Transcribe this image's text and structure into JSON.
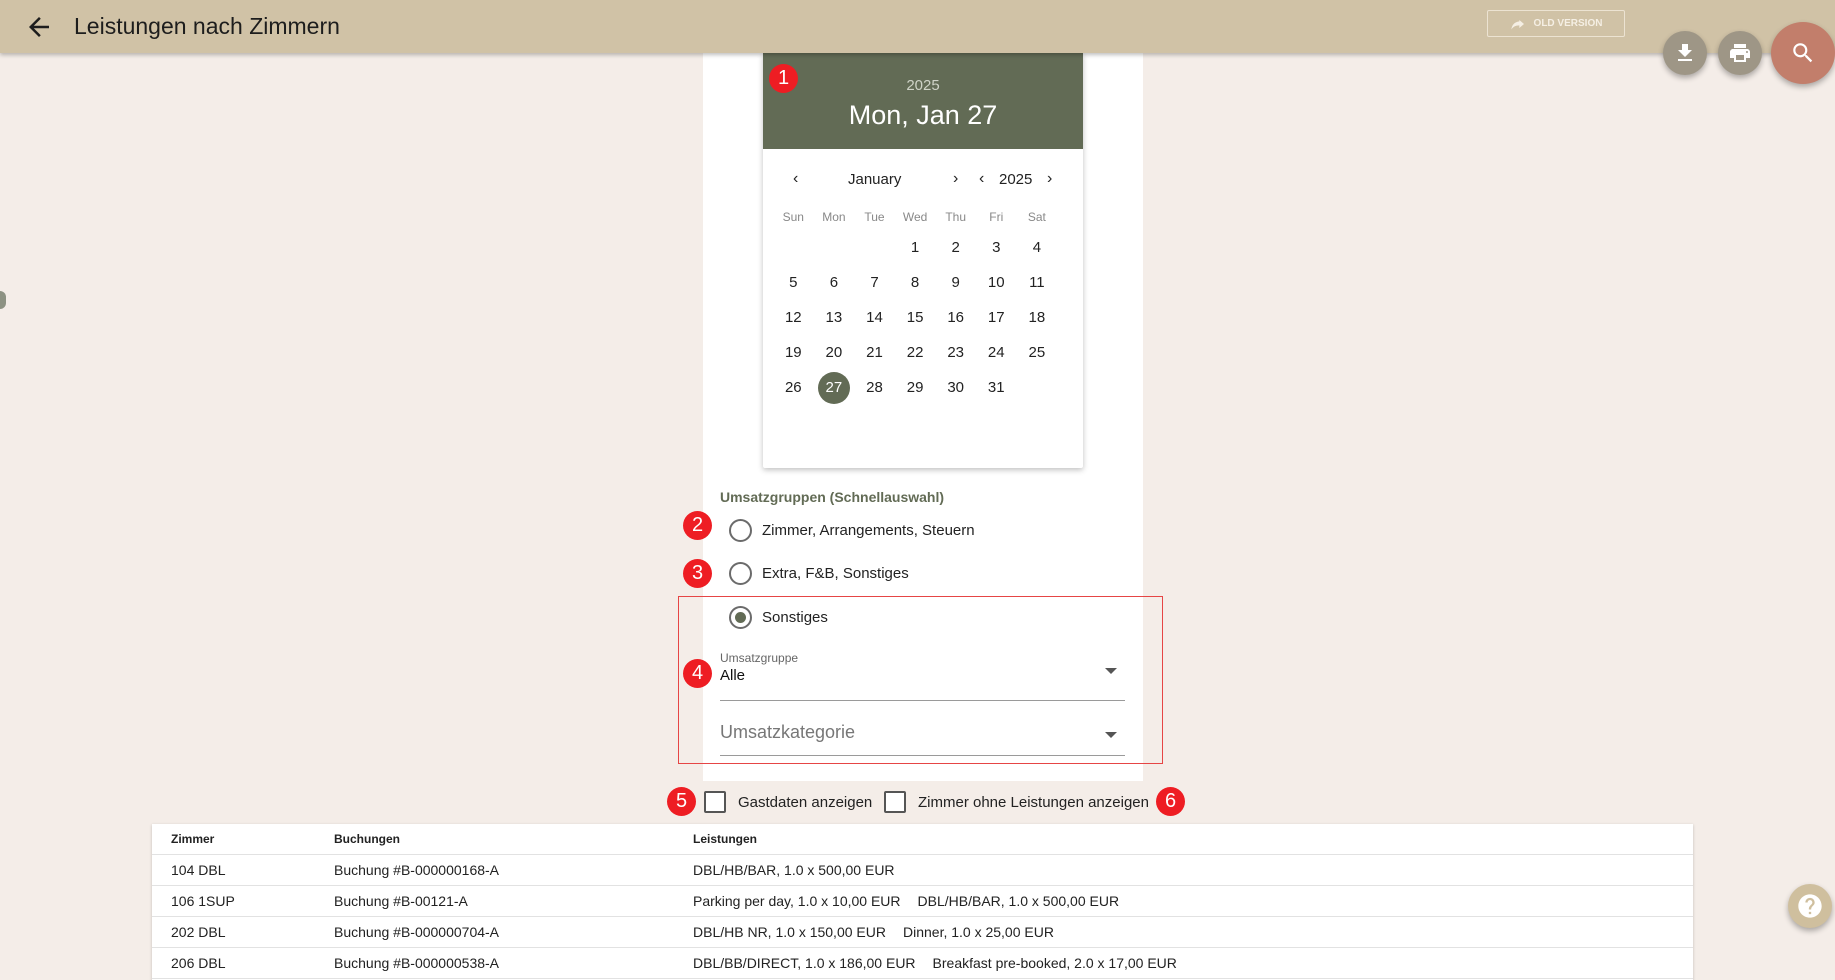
{
  "header": {
    "title": "Leistungen nach Zimmern",
    "old_version_label": "OLD VERSION"
  },
  "datepicker": {
    "header_year": "2025",
    "header_date": "Mon, Jan 27",
    "month": "January",
    "year": "2025",
    "weekdays": [
      "Sun",
      "Mon",
      "Tue",
      "Wed",
      "Thu",
      "Fri",
      "Sat"
    ],
    "weeks": [
      [
        "",
        "",
        "",
        "1",
        "2",
        "3",
        "4"
      ],
      [
        "5",
        "6",
        "7",
        "8",
        "9",
        "10",
        "11"
      ],
      [
        "12",
        "13",
        "14",
        "15",
        "16",
        "17",
        "18"
      ],
      [
        "19",
        "20",
        "21",
        "22",
        "23",
        "24",
        "25"
      ],
      [
        "26",
        "27",
        "28",
        "29",
        "30",
        "31",
        ""
      ]
    ],
    "selected_day": "27"
  },
  "filters": {
    "section_label": "Umsatzgruppen (Schnellauswahl)",
    "radio_options": [
      {
        "label": "Zimmer, Arrangements, Steuern",
        "checked": false
      },
      {
        "label": "Extra, F&B, Sonstiges",
        "checked": false
      },
      {
        "label": "Sonstiges",
        "checked": true
      }
    ],
    "umsatzgruppe_label": "Umsatzgruppe",
    "umsatzgruppe_value": "Alle",
    "umsatzkategorie_placeholder": "Umsatzkategorie",
    "checkbox_gastdaten": "Gastdaten anzeigen",
    "checkbox_zimmer_ohne": "Zimmer ohne Leistungen anzeigen"
  },
  "badges": [
    "1",
    "2",
    "3",
    "4",
    "5",
    "6"
  ],
  "table": {
    "columns": [
      "Zimmer",
      "Buchungen",
      "Leistungen"
    ],
    "rows": [
      {
        "zimmer": "104 DBL",
        "buchung": "Buchung #B-000000168-A",
        "leistungen": [
          "DBL/HB/BAR, 1.0 x 500,00 EUR"
        ]
      },
      {
        "zimmer": "106 1SUP",
        "buchung": "Buchung #B-00121-A",
        "leistungen": [
          "Parking per day, 1.0 x 10,00 EUR",
          "DBL/HB/BAR, 1.0 x 500,00 EUR"
        ]
      },
      {
        "zimmer": "202 DBL",
        "buchung": "Buchung #B-000000704-A",
        "leistungen": [
          "DBL/HB NR, 1.0 x 150,00 EUR",
          "Dinner, 1.0 x 25,00 EUR"
        ]
      },
      {
        "zimmer": "206 DBL",
        "buchung": "Buchung #B-000000538-A",
        "leistungen": [
          "DBL/BB/DIRECT, 1.0 x 186,00 EUR",
          "Breakfast pre-booked, 2.0 x 17,00 EUR"
        ]
      }
    ]
  },
  "colors": {
    "topbar": "#d0c2a6",
    "accent": "#626b55",
    "badge": "#ee1d23",
    "search_fab": "#c27e6b"
  },
  "icons": [
    "arrow-left-icon",
    "share-arrow-icon",
    "download-icon",
    "print-icon",
    "search-icon",
    "help-icon"
  ]
}
